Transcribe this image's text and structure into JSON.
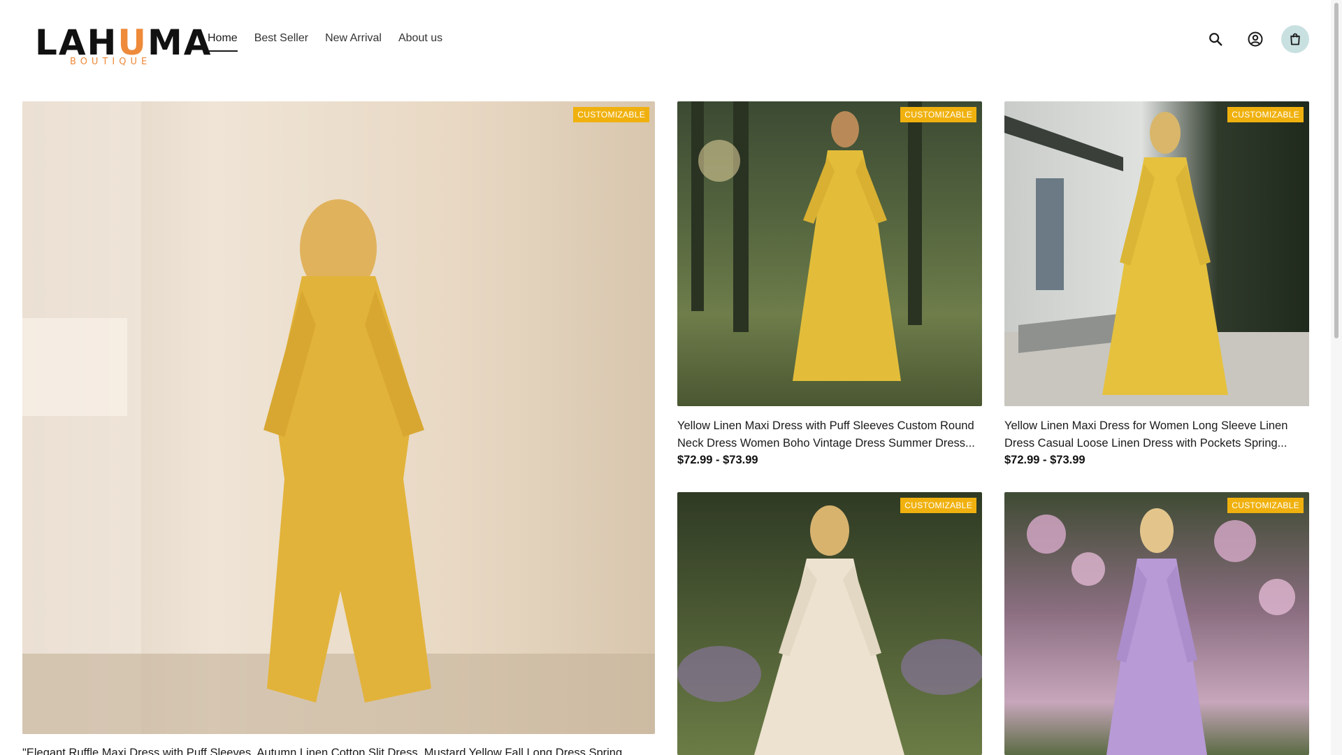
{
  "brand": {
    "logo_main_a": "LAH",
    "logo_main_accent": "U",
    "logo_main_b": "MA",
    "logo_sub": "BOUTIQUE"
  },
  "nav": {
    "items": [
      {
        "label": "Home",
        "active": true
      },
      {
        "label": "Best Seller",
        "active": false
      },
      {
        "label": "New Arrival",
        "active": false
      },
      {
        "label": "About us",
        "active": false
      }
    ]
  },
  "icons": {
    "search": "search-icon",
    "account": "user-circle-icon",
    "cart": "shopping-bag-icon"
  },
  "colors": {
    "badge": "#f0b10f",
    "logo_accent": "#ee8a3a",
    "cart_bg": "#c9e0e1"
  },
  "products": [
    {
      "badge": "CUSTOMIZABLE",
      "title": "\"Elegant Ruffle Maxi Dress with Puff Sleeves, Autumn Linen Cotton Slit Dress, Mustard Yellow Fall Long Dress Spring",
      "price": ""
    },
    {
      "badge": "CUSTOMIZABLE",
      "title": "Yellow Linen Maxi Dress with Puff Sleeves Custom Round Neck Dress Women Boho Vintage Dress Summer Dress...",
      "price": "$72.99 - $73.99"
    },
    {
      "badge": "CUSTOMIZABLE",
      "title": "Yellow Linen Maxi Dress for Women Long Sleeve Linen Dress Casual Loose Linen Dress with Pockets Spring...",
      "price": "$72.99 - $73.99"
    },
    {
      "badge": "CUSTOMIZABLE",
      "title": "",
      "price": ""
    },
    {
      "badge": "CUSTOMIZABLE",
      "title": "",
      "price": ""
    }
  ]
}
